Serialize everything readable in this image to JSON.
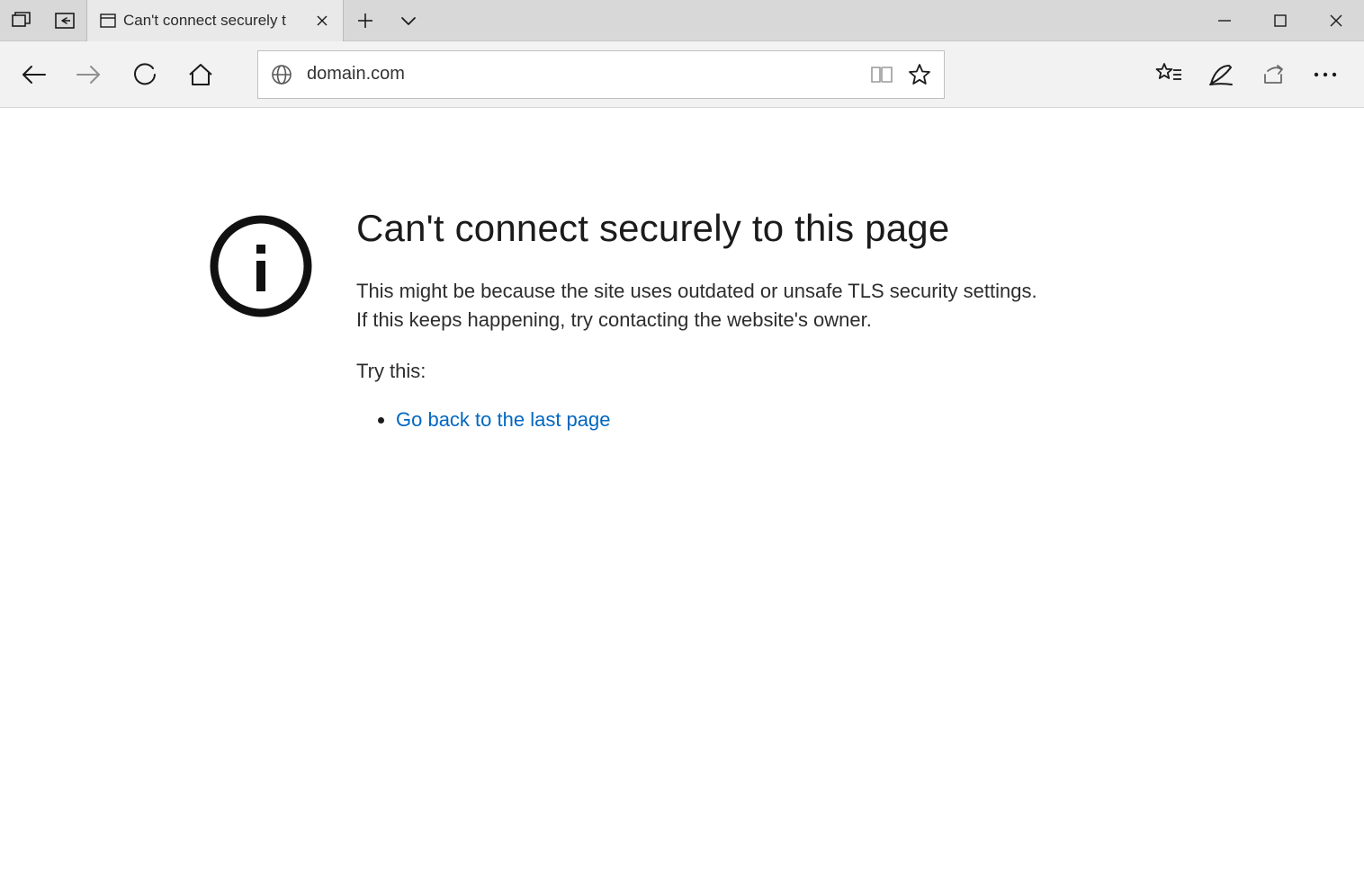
{
  "tab": {
    "title": "Can't connect securely t"
  },
  "address": {
    "url": "domain.com"
  },
  "error": {
    "heading": "Can't connect securely to this page",
    "description": "This might be because the site uses outdated or unsafe TLS security settings. If this keeps happening, try contacting the website's owner.",
    "try_label": "Try this:",
    "suggestion_link": "Go back to the last page"
  }
}
